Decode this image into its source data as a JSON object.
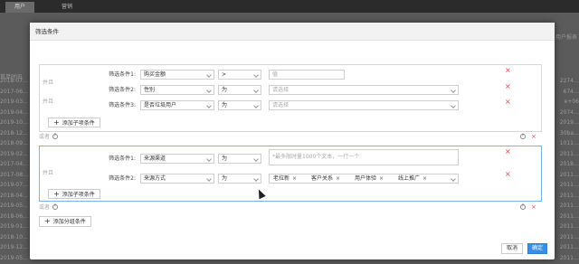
{
  "background": {
    "tabs": [
      "用户",
      "营销"
    ],
    "header": "首单时间",
    "dates": [
      "2018-07…",
      "2017-06…",
      "2019-03…",
      "2019-04…",
      "2019-10…",
      "2018-12…",
      "2018-09…",
      "2019-02…",
      "2017-04…",
      "2017-08…",
      "2019-07…",
      "2018-04…",
      "2019-05…",
      "2018-06…",
      "2019-01…",
      "2018-10…",
      "2019-12…",
      "2019-05…"
    ],
    "right_values": [
      "2274…",
      "674…",
      "e+06",
      "2074…",
      "2019…",
      "30ba…",
      "1011…",
      "2011…",
      "2018…",
      "2011…",
      "2011…",
      "2011…",
      "2011…",
      "2011…",
      "2011…",
      "2011…",
      "2011…",
      "2011…"
    ],
    "right_header": "用户报表"
  },
  "modal": {
    "title": "筛选条件",
    "or_label": "并且",
    "and_or_label": "或者",
    "add_sub_label": "添加子项条件",
    "add_group_label": "添加分组条件",
    "cancel_label": "取消",
    "confirm_label": "确定",
    "question_glyph": "?",
    "delete_glyph": "×",
    "group1": {
      "rows": [
        {
          "name": "筛选条件1:",
          "field": "购买金额",
          "op": ">",
          "value_placeholder": "值"
        },
        {
          "name": "筛选条件2:",
          "field": "性别",
          "op": "为",
          "value_placeholder": "请选择"
        },
        {
          "name": "筛选条件3:",
          "field": "是否垃圾用户",
          "op": "为",
          "value_placeholder": "请选择"
        }
      ]
    },
    "group2": {
      "rows": [
        {
          "name": "筛选条件1:",
          "field": "来源渠道",
          "op": "为",
          "value_placeholder": "*最多限时量1000个文本，一行一个"
        },
        {
          "name": "筛选条件2:",
          "field": "来源方式",
          "op": "为",
          "tags": [
            "老拉新",
            "客户关系",
            "用户体验",
            "线上推广"
          ]
        }
      ]
    }
  }
}
